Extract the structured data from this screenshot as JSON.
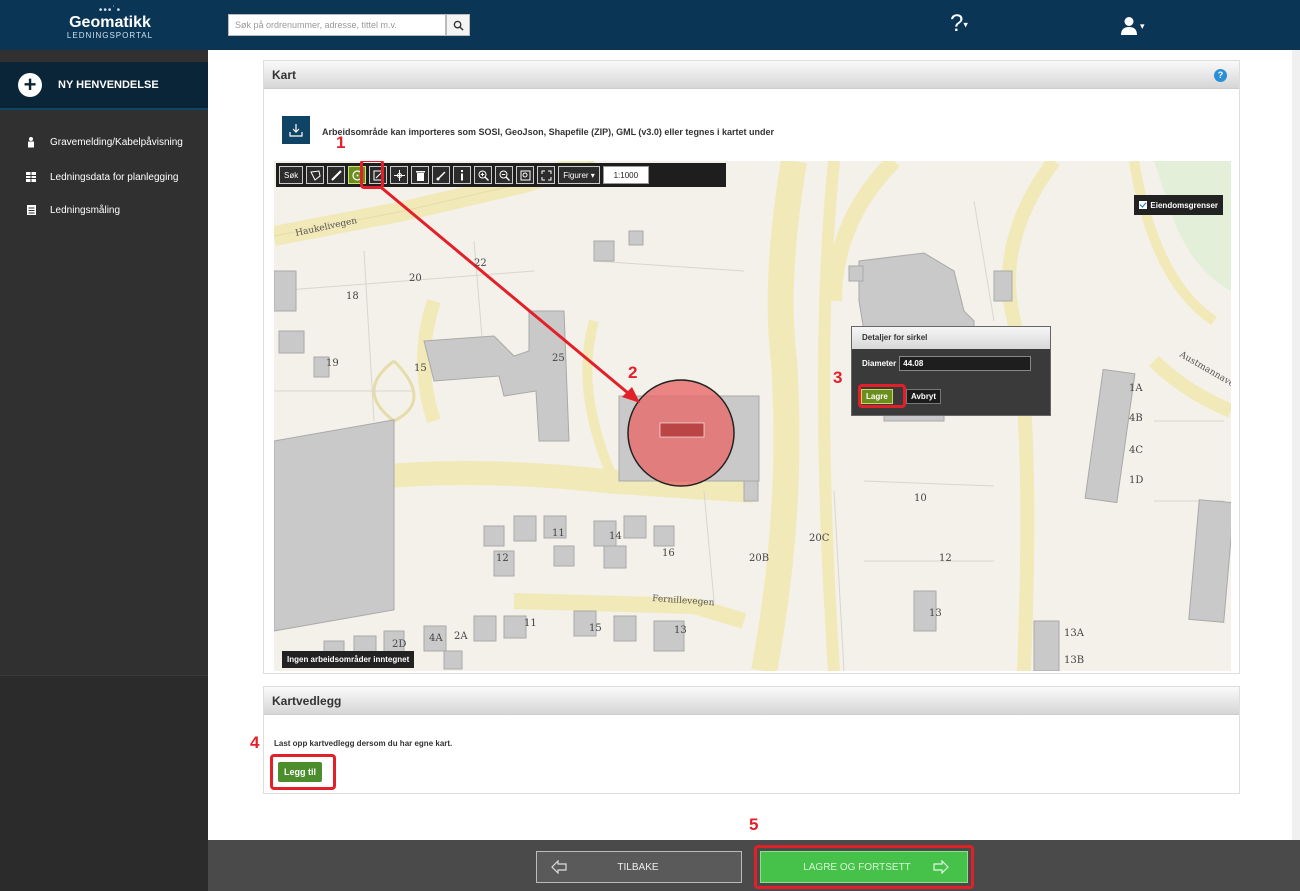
{
  "header": {
    "logo_dots": "•••˙•",
    "logo_brand": "Geomatikk",
    "logo_sub": "LEDNINGSPORTAL",
    "search_placeholder": "Søk på ordrenummer, adresse, tittel m.v.",
    "help_label": "?"
  },
  "sidebar": {
    "new_request_label": "NY HENVENDELSE",
    "items": [
      {
        "label": "Gravemelding/Kabelpåvisning",
        "icon": "person-icon"
      },
      {
        "label": "Ledningsdata for planlegging",
        "icon": "grid-icon"
      },
      {
        "label": "Ledningsmåling",
        "icon": "document-icon"
      }
    ]
  },
  "map_panel": {
    "title": "Kart",
    "help": "?",
    "import_text": "Arbeidsområde kan importeres som SOSI, GeoJson, Shapefile (ZIP), GML (v3.0) eller tegnes i kartet under",
    "toolbar": {
      "search_label": "Søk",
      "figures_label": "Figurer",
      "scale_value": "1:1000"
    },
    "property_toggle": "Eiendomsgrenser",
    "no_area_label": "Ingen arbeidsområder inntegnet",
    "street_labels": [
      "Haukelivegen",
      "Fernillevegen",
      "Austmannavegen"
    ],
    "parcel_numbers": [
      "22",
      "20",
      "18",
      "19",
      "15",
      "25",
      "10",
      "12",
      "20B",
      "20C",
      "1A",
      "4B",
      "4C",
      "1D",
      "13",
      "13A",
      "13B",
      "12",
      "2D",
      "11",
      "14",
      "16",
      "2A",
      "4A",
      "15",
      "11",
      "13"
    ],
    "circle_popup": {
      "title": "Detaljer for sirkel",
      "diameter_label": "Diameter",
      "diameter_value": "44.08",
      "save_label": "Lagre",
      "cancel_label": "Avbryt"
    }
  },
  "attachments_panel": {
    "title": "Kartvedlegg",
    "text": "Last opp kartvedlegg dersom du har egne kart.",
    "add_label": "Legg til"
  },
  "footer": {
    "back_label": "TILBAKE",
    "save_next_label": "LAGRE OG FORTSETT"
  },
  "annotations": [
    "1",
    "2",
    "3",
    "4",
    "5"
  ],
  "colors": {
    "header": "#0b3554",
    "sidebar": "#303030",
    "annotation": "#e2202a",
    "primary_green": "#46c24a",
    "circle_fill": "#e96a6a"
  }
}
